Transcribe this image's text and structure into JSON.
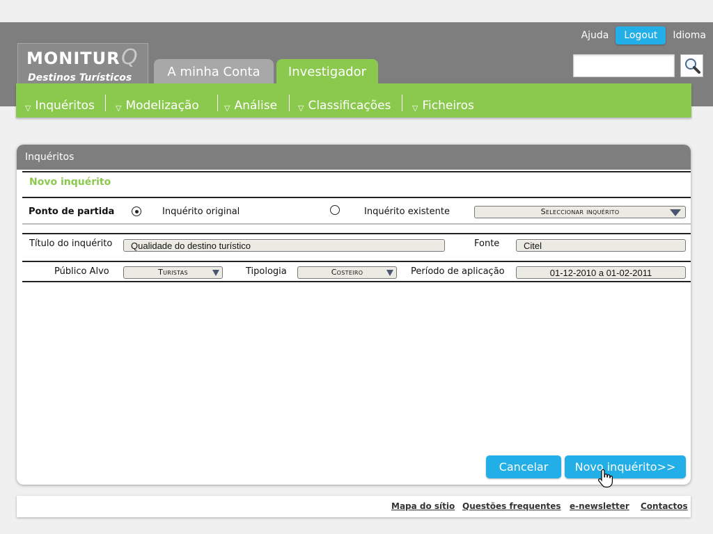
{
  "header": {
    "links": {
      "help": "Ajuda",
      "logout": "Logout",
      "language": "Idioma"
    },
    "search": {
      "value": "",
      "placeholder": ""
    },
    "logo": {
      "name": "MONITUR",
      "mark": "Q",
      "subtitle": "Destinos Turísticos"
    },
    "tabs": [
      {
        "label": "A minha Conta",
        "active": false
      },
      {
        "label": "Investigador",
        "active": true
      }
    ],
    "menu": [
      "Inquéritos",
      "Modelização",
      "Análise",
      "Classificações",
      "Ficheiros"
    ],
    "colors": {
      "green": "#8bc94e",
      "gray": "#7e7e7e",
      "blue": "#22aee6"
    }
  },
  "panel": {
    "title": "Inquéritos",
    "section_title": "Novo inquérito",
    "start": {
      "label": "Ponto de partida",
      "option_original": "Inquérito original",
      "option_existing": "Inquérito existente",
      "selected": "Inquérito original",
      "select_placeholder": "Seleccionar inquérito"
    },
    "form": {
      "title_label": "Título do inquérito",
      "title_value": "Qualidade do destino turístico",
      "source_label": "Fonte",
      "source_value": "Citel",
      "audience_label": "Público Alvo",
      "audience_value": "Turistas",
      "type_label": "Tipologia",
      "type_value": "Costeiro",
      "period_label": "Período de aplicação",
      "period_value": "01-12-2010 a 01-02-2011"
    },
    "buttons": {
      "cancel": "Cancelar",
      "submit": "Novo inquérito>>"
    }
  },
  "footer": {
    "links": [
      "Mapa do sítio",
      "Questões frequentes",
      "e-newsletter",
      "Contactos"
    ]
  }
}
